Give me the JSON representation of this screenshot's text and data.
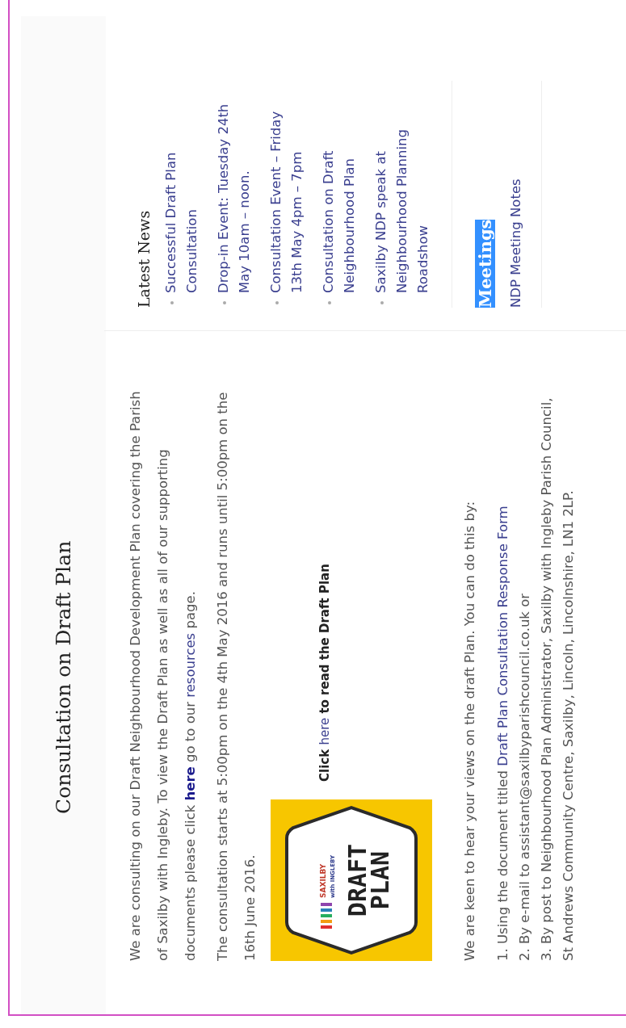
{
  "title": "Consultation on Draft Plan",
  "intro": [
    {
      "parts": [
        {
          "text": "We are consulting on our Draft Neighbourhood Development Plan covering the Parish of Saxilby with Ingleby. To view the Draft Plan as well as all of our supporting documents please click "
        },
        {
          "link": "here",
          "strong": true
        },
        {
          "text": " go to our "
        },
        {
          "link": "resources",
          "strong": false
        },
        {
          "text": " page."
        }
      ]
    },
    {
      "parts": [
        {
          "text": "The consultation starts at 5:00pm on the 4th May 2016 and runs until 5:00pm on the 16th June 2016."
        }
      ]
    }
  ],
  "logo": {
    "brand_top": "SAXILBY",
    "brand_bottom": "with INGLEBY",
    "lines": [
      "DRAFT",
      "PLAN"
    ]
  },
  "download": {
    "before": "Click ",
    "link": "here",
    "after": " to read the Draft Plan"
  },
  "views": "We are keen to hear your views on the draft Plan. You can do this by:",
  "options": [
    {
      "parts": [
        {
          "text": "1. Using the document titled "
        },
        {
          "link": "Draft Plan Consultation Response Form",
          "strong": false
        }
      ]
    },
    {
      "parts": [
        {
          "text": "2. By e-mail to assistant@saxilbyparishcouncil.co.uk or"
        }
      ]
    },
    {
      "parts": [
        {
          "text": "3. By post to Neighbourhood Plan Administrator, Saxilby with Ingleby Parish Council, St Andrews Community Centre, Saxilby, Lincoln, Lincolnshire, LN1 2LP."
        }
      ]
    }
  ],
  "sidebar": {
    "news": {
      "title": "Latest News",
      "items": [
        "Successful Draft Plan Consultation",
        "Drop-in Event: Tuesday 24th May 10am – noon.",
        "Consultation Event – Friday 13th May 4pm – 7pm",
        "Consultation on Draft Neighbourhood Plan",
        "Saxilby NDP speak at Neighbourhood Planning Roadshow"
      ]
    },
    "meetings": {
      "title": "Meetings",
      "highlighted": true,
      "items": [
        "NDP Meeting Notes"
      ]
    }
  }
}
